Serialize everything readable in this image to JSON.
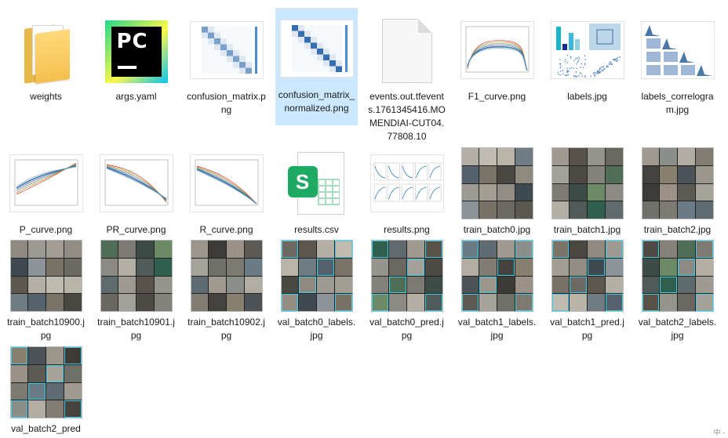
{
  "files": [
    {
      "name": "weights",
      "kind": "folder"
    },
    {
      "name": "args.yaml",
      "kind": "pycharm"
    },
    {
      "name": "confusion_matrix.png",
      "kind": "matrix"
    },
    {
      "name": "confusion_matrix_normalized.png",
      "kind": "matrix-dark",
      "selected": true
    },
    {
      "name": "events.out.tfevents.1761345416.MOMENDIAI-CUT04.77808.10",
      "kind": "file"
    },
    {
      "name": "F1_curve.png",
      "kind": "curve-f1"
    },
    {
      "name": "labels.jpg",
      "kind": "labels"
    },
    {
      "name": "labels_correlogram.jpg",
      "kind": "correlogram"
    },
    {
      "name": "P_curve.png",
      "kind": "curve-p"
    },
    {
      "name": "PR_curve.png",
      "kind": "curve-pr"
    },
    {
      "name": "R_curve.png",
      "kind": "curve-r"
    },
    {
      "name": "results.csv",
      "kind": "csv"
    },
    {
      "name": "results.png",
      "kind": "results"
    },
    {
      "name": "train_batch0.jpg",
      "kind": "photo"
    },
    {
      "name": "train_batch1.jpg",
      "kind": "photo"
    },
    {
      "name": "train_batch2.jpg",
      "kind": "photo"
    },
    {
      "name": "train_batch10900.jpg",
      "kind": "photo"
    },
    {
      "name": "train_batch10901.jpg",
      "kind": "photo"
    },
    {
      "name": "train_batch10902.jpg",
      "kind": "photo"
    },
    {
      "name": "val_batch0_labels.jpg",
      "kind": "photo"
    },
    {
      "name": "val_batch0_pred.jpg",
      "kind": "photo"
    },
    {
      "name": "val_batch1_labels.jpg",
      "kind": "photo"
    },
    {
      "name": "val_batch1_pred.jpg",
      "kind": "photo"
    },
    {
      "name": "val_batch2_labels.jpg",
      "kind": "photo"
    },
    {
      "name": "val_batch2_pred",
      "kind": "photo"
    }
  ],
  "csv_badge": "S",
  "pycharm_text": "PC",
  "tray_text": "中 -"
}
